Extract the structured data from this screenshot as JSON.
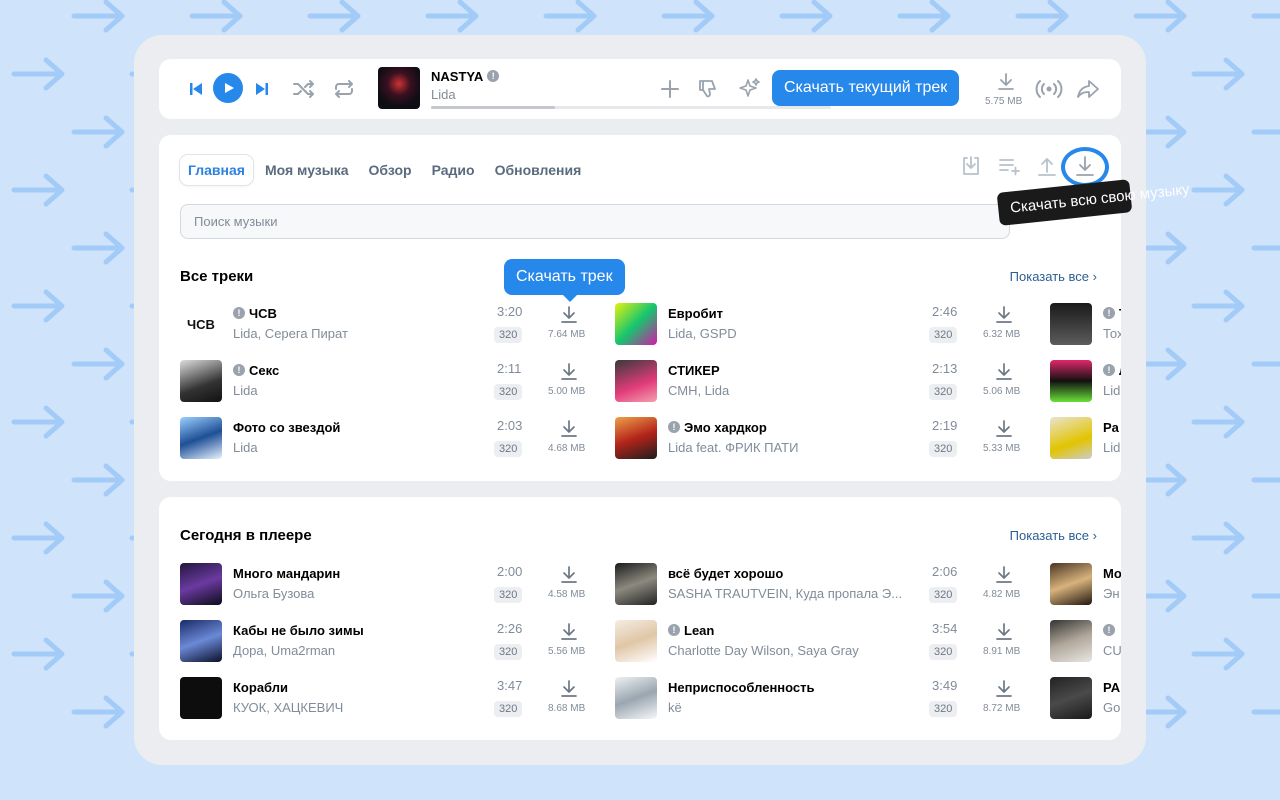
{
  "player": {
    "track_title": "NASTYA",
    "track_artist": "Lida",
    "progress": 0.31,
    "file_size": "5.75 MB",
    "tooltip": "Скачать текущий трек"
  },
  "tabs": [
    {
      "label": "Главная",
      "active": true
    },
    {
      "label": "Моя музыка",
      "active": false
    },
    {
      "label": "Обзор",
      "active": false
    },
    {
      "label": "Радио",
      "active": false
    },
    {
      "label": "Обновления",
      "active": false
    }
  ],
  "search": {
    "placeholder": "Поиск музыки"
  },
  "download_all_tooltip": "Скачать всю свою музыку",
  "download_track_tooltip": "Скачать трек",
  "all_tracks": {
    "title": "Все треки",
    "show_all": "Показать все",
    "items": [
      {
        "title": "ЧСВ",
        "artist": "Lida, Серега Пират",
        "time": "3:20",
        "bitrate": "320",
        "size": "7.64 MB",
        "badge": true
      },
      {
        "title": "Евробит",
        "artist": "Lida, GSPD",
        "time": "2:46",
        "bitrate": "320",
        "size": "6.32 MB",
        "badge": false
      },
      {
        "title": "Т",
        "artist": "Тох",
        "badge": true
      },
      {
        "title": "Секс",
        "artist": "Lida",
        "time": "2:11",
        "bitrate": "320",
        "size": "5.00 MB",
        "badge": true
      },
      {
        "title": "СТИКЕР",
        "artist": "СМН, Lida",
        "time": "2:13",
        "bitrate": "320",
        "size": "5.06 MB",
        "badge": false
      },
      {
        "title": "Л",
        "artist": "Lid",
        "badge": true
      },
      {
        "title": "Фото со звездой",
        "artist": "Lida",
        "time": "2:03",
        "bitrate": "320",
        "size": "4.68 MB",
        "badge": false
      },
      {
        "title": "Эмо хардкор",
        "artist": "Lida feat. ФРИК ПАТИ",
        "time": "2:19",
        "bitrate": "320",
        "size": "5.33 MB",
        "badge": true
      },
      {
        "title": "Pa",
        "artist": "Lid",
        "badge": false
      }
    ]
  },
  "today": {
    "title": "Сегодня в плеере",
    "show_all": "Показать все",
    "items": [
      {
        "title": "Много мандарин",
        "artist": "Ольга Бузова",
        "time": "2:00",
        "bitrate": "320",
        "size": "4.58 MB",
        "badge": false
      },
      {
        "title": "всё будет хорошо",
        "artist": "SASHA TRAUTVEIN, Куда пропала Э...",
        "time": "2:06",
        "bitrate": "320",
        "size": "4.82 MB",
        "badge": false
      },
      {
        "title": "Мо",
        "artist": "Эн",
        "badge": false
      },
      {
        "title": "Кабы не было зимы",
        "artist": "Дора, Uma2rman",
        "time": "2:26",
        "bitrate": "320",
        "size": "5.56 MB",
        "badge": false
      },
      {
        "title": "Lean",
        "artist": "Charlotte Day Wilson, Saya Gray",
        "time": "3:54",
        "bitrate": "320",
        "size": "8.91 MB",
        "badge": true
      },
      {
        "title": "",
        "artist": "CU",
        "badge": true
      },
      {
        "title": "Корабли",
        "artist": "КУОК, ХАЦКЕВИЧ",
        "time": "3:47",
        "bitrate": "320",
        "size": "8.68 MB",
        "badge": false
      },
      {
        "title": "Неприспособленность",
        "artist": "kё",
        "time": "3:49",
        "bitrate": "320",
        "size": "8.72 MB",
        "badge": false
      },
      {
        "title": "PA",
        "artist": "Go",
        "badge": false
      }
    ]
  },
  "colors": {
    "accent": "#2688eb",
    "background": "#cfe3fb",
    "muted": "#818c99"
  }
}
